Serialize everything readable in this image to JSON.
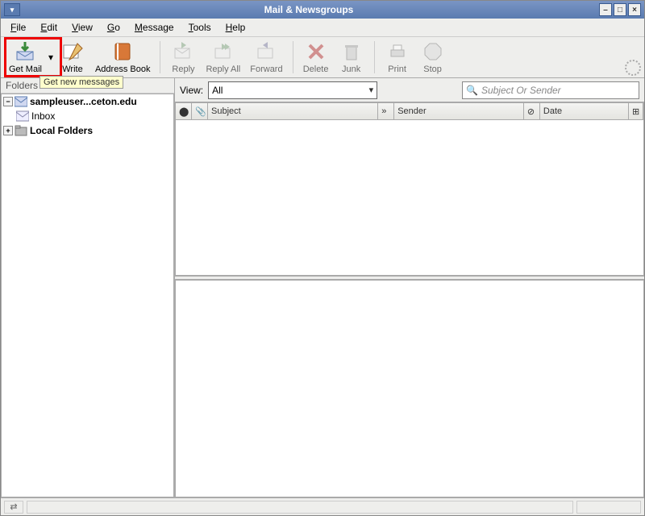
{
  "title": "Mail & Newsgroups",
  "menu": {
    "file": "File",
    "edit": "Edit",
    "view": "View",
    "go": "Go",
    "message": "Message",
    "tools": "Tools",
    "help": "Help"
  },
  "toolbar": {
    "get_mail": "Get Mail",
    "write": "Write",
    "address_book": "Address Book",
    "reply": "Reply",
    "reply_all": "Reply All",
    "forward": "Forward",
    "delete": "Delete",
    "junk": "Junk",
    "print": "Print",
    "stop": "Stop"
  },
  "tooltip": "Get new messages",
  "folders_header": "Folders",
  "folders": {
    "account": "sampleuser...ceton.edu",
    "inbox": "Inbox",
    "local": "Local Folders"
  },
  "view_label": "View:",
  "view_value": "All",
  "search_placeholder": "Subject Or Sender",
  "columns": {
    "subject": "Subject",
    "sender": "Sender",
    "date": "Date"
  }
}
